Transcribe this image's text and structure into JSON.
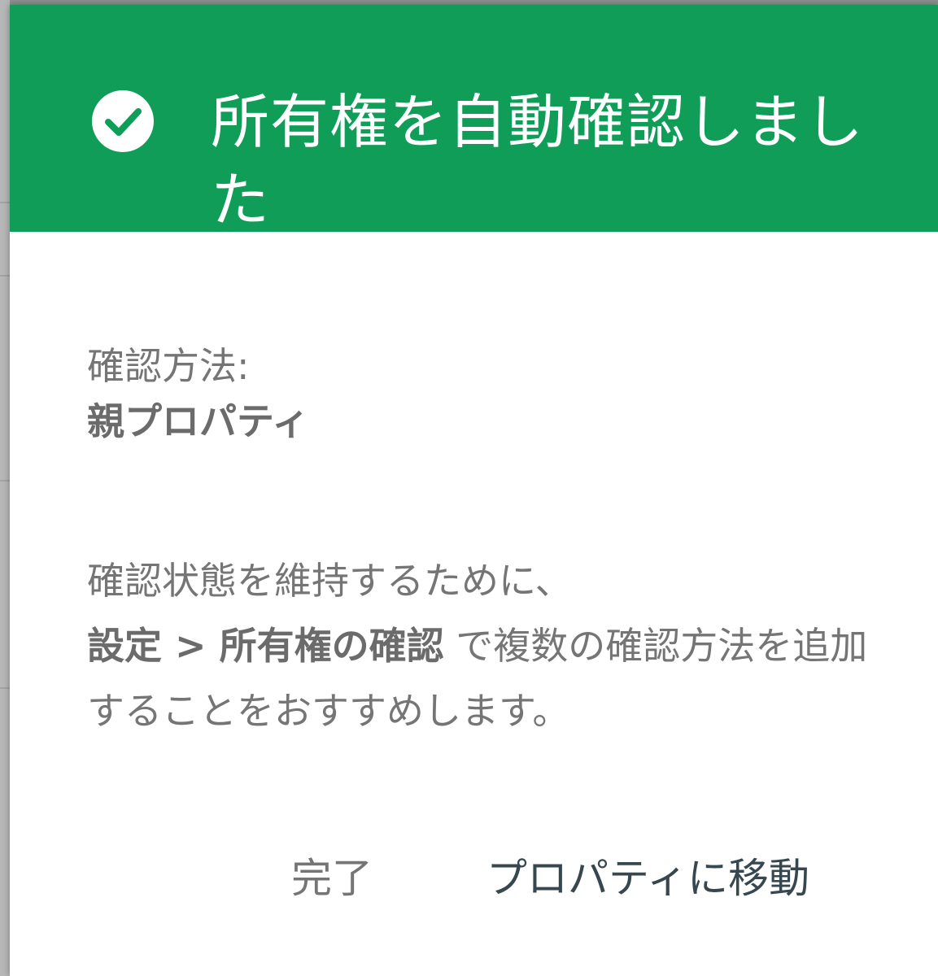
{
  "dialog": {
    "header_color": "#0f9d58",
    "icon": "check-circle-icon",
    "title": "所有権を自動確認しました",
    "method_label": "確認方法:",
    "method_value": "親プロパティ",
    "recommend_line1": "確認状態を維持するために、",
    "recommend_bold": "設定 > 所有権の確認",
    "recommend_rest": " で複数の確認方法を追加することをおすすめします。"
  },
  "actions": {
    "done_label": "完了",
    "go_label": "プロパティに移動"
  }
}
